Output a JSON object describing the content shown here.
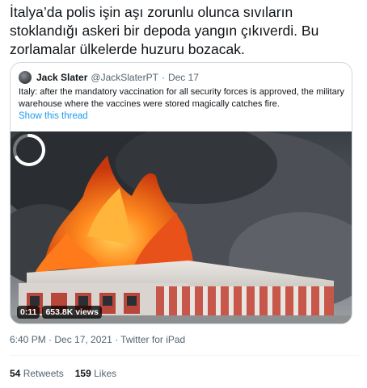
{
  "tweet": {
    "text": "İtalya’da polis işin aşı zorunlu olunca sıvıların stoklandığı askeri bir depoda yangın çıkıverdi. Bu zorlamalar ülkelerde huzuru bozacak.",
    "timestamp": "6:40 PM · Dec 17, 2021 · Twitter for iPad",
    "retweets_count": "54",
    "retweets_label": "Retweets",
    "likes_count": "159",
    "likes_label": "Likes"
  },
  "quote": {
    "name": "Jack Slater",
    "handle": "@JackSlaterPT",
    "separator": "·",
    "date": "Dec 17",
    "text": "Italy: after the mandatory vaccination for all security forces is approved, the military warehouse where the vaccines were stored magically catches fire.",
    "show_thread": "Show this thread"
  },
  "video": {
    "duration": "0:11",
    "views": "653.8K views",
    "state": "loading"
  },
  "colors": {
    "link": "#1d9bf0",
    "secondary_text": "#536471",
    "border": "#cfd9de"
  }
}
